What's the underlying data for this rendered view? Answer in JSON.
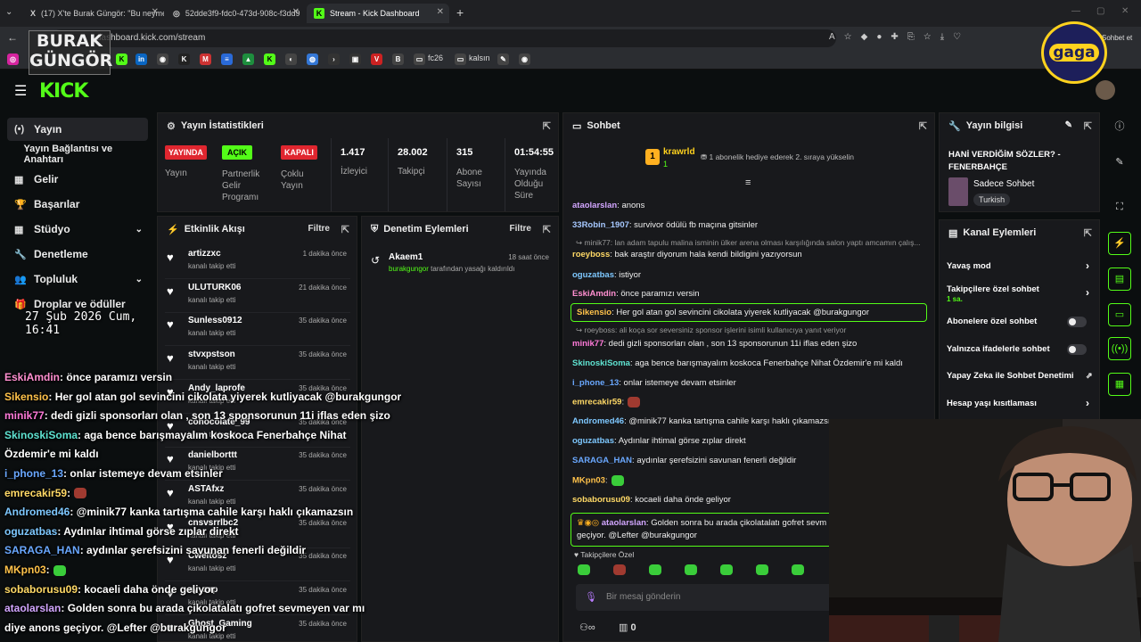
{
  "browser": {
    "tabs": [
      {
        "label": "(17) X'te Burak Güngör: \"Bu neyme",
        "icon": "X"
      },
      {
        "label": "52dde3f9-fdc0-473d-908c-f3dd9",
        "icon": "◎"
      },
      {
        "label": "Stream - Kick Dashboard",
        "icon": "K"
      }
    ],
    "url": "dashboard.kick.com/stream",
    "profile_label": "Sohbet et",
    "bookmarks": [
      "fc26",
      "kalsın"
    ]
  },
  "watermark": {
    "line1": "BURAK",
    "line2": "GÜNGÖR",
    "badge": "gaga"
  },
  "sidebar": {
    "items": [
      {
        "label": "Yayın",
        "icon": "(•)"
      },
      {
        "label": "Yayın Bağlantısı ve Anahtarı",
        "icon": ""
      },
      {
        "label": "Gelir",
        "icon": "▦"
      },
      {
        "label": "Başarılar",
        "icon": "🏆"
      },
      {
        "label": "Stüdyo",
        "icon": "▦",
        "chev": "⌄"
      },
      {
        "label": "Denetleme",
        "icon": "🔧"
      },
      {
        "label": "Topluluk",
        "icon": "👥",
        "chev": "⌄"
      },
      {
        "label": "Droplar ve ödüller",
        "icon": "🎁"
      }
    ],
    "clock": "27 Şub 2026 Cum, 16:41"
  },
  "stats": {
    "title": "Yayın İstatistikleri",
    "cols": [
      {
        "badge": "YAYINDA",
        "color": "#e0262f",
        "label": "Yayın"
      },
      {
        "badge": "AÇIK",
        "color": "#53fc18",
        "label": "Partnerlik Gelir Programı"
      },
      {
        "badge": "KAPALI",
        "color": "#e0262f",
        "label": "Çoklu Yayın"
      },
      {
        "value": "1.417",
        "label": "İzleyici"
      },
      {
        "value": "28.002",
        "label": "Takipçi"
      },
      {
        "value": "315",
        "label": "Abone Sayısı"
      },
      {
        "value": "01:54:55",
        "label": "Yayında Olduğu Süre"
      }
    ]
  },
  "activity": {
    "title": "Etkinlik Akışı",
    "filter": "Filtre",
    "items": [
      {
        "name": "artizzxc",
        "sub": "kanalı takip etti",
        "time": "1 dakika önce"
      },
      {
        "name": "ULUTURK06",
        "sub": "kanalı takip etti",
        "time": "21 dakika önce"
      },
      {
        "name": "Sunless0912",
        "sub": "kanalı takip etti",
        "time": "35 dakika önce"
      },
      {
        "name": "stvxpstson",
        "sub": "kanalı takip etti",
        "time": "35 dakika önce"
      },
      {
        "name": "Andy_laprofe",
        "sub": "kanalı takip etti",
        "time": "35 dakika önce"
      },
      {
        "name": "cohocolate_99",
        "sub": "kanalı takip etti",
        "time": "35 dakika önce"
      },
      {
        "name": "danielborttt",
        "sub": "kanalı takip etti",
        "time": "35 dakika önce"
      },
      {
        "name": "ASTAfxz",
        "sub": "kanalı takip etti",
        "time": "35 dakika önce"
      },
      {
        "name": "cnsvsrrlbc2",
        "sub": "kanalı takip etti",
        "time": "35 dakika önce"
      },
      {
        "name": "Cweltosz",
        "sub": "kanalı takip etti",
        "time": "35 dakika önce"
      },
      {
        "name": "ay_zap",
        "sub": "kanalı takip etti",
        "time": "35 dakika önce"
      },
      {
        "name": "Ghost_Gaming",
        "sub": "kanalı takip etti",
        "time": "35 dakika önce"
      }
    ]
  },
  "moderation": {
    "title": "Denetim Eylemleri",
    "filter": "Filtre",
    "item": {
      "name": "Akaem1",
      "time": "18 saat önce",
      "by": "burakgungor",
      "text": "tarafından yasağı kaldırıldı"
    }
  },
  "chat": {
    "title": "Sohbet",
    "pinned_user": "krawrld",
    "pinned_rank": "1",
    "pinned_count": "1",
    "gift_text": "1 abonelik hediye ederek 2. sıraya yükselin",
    "messages": [
      {
        "user": "ataolarslan",
        "color": "#d2a6ff",
        "text": ": anons"
      },
      {
        "user": "33Robin_1907",
        "color": "#a6c8ff",
        "text": ": survivor ödülü fb maçına gitsinler"
      },
      {
        "sys": "minik77: lan adam tapulu malina isminin ülker arena olması karşılığında salon yaptı amcamın çalış..."
      },
      {
        "user": "roeyboss",
        "color": "#ffd966",
        "text": ": bak araştır diyorum hala kendi bildigini yazıyorsun"
      },
      {
        "user": "oguzatbas",
        "color": "#7ec8ff",
        "text": ": istiyor"
      },
      {
        "user": "EskiAmdin",
        "color": "#ff8fd0",
        "text": ": önce paramızı versin"
      },
      {
        "user": "Sikensio",
        "color": "#ffc24a",
        "text": ": Her gol atan gol sevincini cikolata yiyerek kutliyacak @burakgungor",
        "hl": true
      },
      {
        "sys": "roeyboss: ali koça sor seversiniz sponsor işlerini isimli kullanıcıya yanıt veriyor"
      },
      {
        "user": "minik77",
        "color": "#ff7ad9",
        "text": ": dedi gizli sponsorları olan , son 13 sponsorunun 11i iflas eden şizo"
      },
      {
        "user": "SkinoskiSoma",
        "color": "#5fe3d1",
        "text": ": aga bence barışmayalım koskoca Fenerbahçe Nihat Özdemir'e mi kaldı"
      },
      {
        "user": "i_phone_13",
        "color": "#6aa8ff",
        "text": ": onlar istemeye devam etsinler"
      },
      {
        "user": "emrecakir59",
        "color": "#ffd966",
        "text": ":"
      },
      {
        "user": "Andromed46",
        "color": "#7ec8ff",
        "text": ": @minik77 kanka tartışma cahile karşı haklı çıkamazsın"
      },
      {
        "user": "oguzatbas",
        "color": "#7ec8ff",
        "text": ": Aydınlar ihtimal görse zıplar direkt"
      },
      {
        "user": "SARAGA_HAN",
        "color": "#6aa8ff",
        "text": ": aydınlar şerefsizini savunan fenerli değildir"
      },
      {
        "user": "MKpn03",
        "color": "#ffc24a",
        "text": ":"
      },
      {
        "user": "sobaborusu09",
        "color": "#ffd966",
        "text": ": kocaeli daha önde geliyor"
      }
    ],
    "last_user": "ataolarslan",
    "last_text": ": Golden sonra bu arada çikolatalatı gofret sevm",
    "last_text2": "geçiyor. @Lefter @burakgungor",
    "emote_label": "Takipçilere Özel",
    "input_placeholder": "Bir mesaj gönderin",
    "footer_count": "0"
  },
  "info": {
    "title": "Yayın bilgisi",
    "stream_title": "HANİ VERDİĞİM SÖZLER? - FENERBAHÇE",
    "category": "Sadece Sohbet",
    "language": "Turkish",
    "actions_title": "Kanal Eylemleri",
    "actions": [
      {
        "label": "Yavaş mod",
        "type": "chev"
      },
      {
        "label": "Takipçilere özel sohbet",
        "sub": "1 sa.",
        "type": "chev"
      },
      {
        "label": "Abonelere özel sohbet",
        "type": "toggle"
      },
      {
        "label": "Yalnızca ifadelerle sohbet",
        "type": "toggle"
      },
      {
        "label": "Yapay Zeka ile Sohbet Denetimi",
        "type": "ext"
      },
      {
        "label": "Hesap yaşı kısıtlaması",
        "type": "chev"
      }
    ]
  },
  "overlay": {
    "lines": [
      {
        "user": "EskiAmdin",
        "color": "#ff8fd0",
        "text": ": önce paramızı versin"
      },
      {
        "user": "Sikensio",
        "color": "#ffc24a",
        "text": ": Her gol atan gol sevincini cikolata yiyerek kutliyacak @burakgungor"
      },
      {
        "user": "minik77",
        "color": "#ff7ad9",
        "text": ": dedi gizli sponsorları olan , son 13 sponsorunun 11i iflas eden şizo"
      },
      {
        "user": "SkinoskiSoma",
        "color": "#5fe3d1",
        "text": ": aga bence barışmayalım koskoca Fenerbahçe Nihat"
      },
      {
        "user": "",
        "color": "#fff",
        "text": "Özdemir'e mi kaldı"
      },
      {
        "user": "i_phone_13",
        "color": "#6aa8ff",
        "text": ": onlar istemeye devam etsinler"
      },
      {
        "user": "emrecakir59",
        "color": "#ffd966",
        "text": ":"
      },
      {
        "user": "Andromed46",
        "color": "#7ec8ff",
        "text": ": @minik77 kanka tartışma cahile karşı haklı çıkamazsın"
      },
      {
        "user": "oguzatbas",
        "color": "#7ec8ff",
        "text": ": Aydınlar ihtimal görse zıplar direkt"
      },
      {
        "user": "SARAGA_HAN",
        "color": "#6aa8ff",
        "text": ": aydınlar şerefsizini savunan fenerli değildir"
      },
      {
        "user": "MKpn03",
        "color": "#ffc24a",
        "text": ":"
      },
      {
        "user": "sobaborusu09",
        "color": "#ffd966",
        "text": ": kocaeli daha önde geliyor"
      },
      {
        "user": "ataolarslan",
        "color": "#d2a6ff",
        "text": ": Golden sonra bu arada çikolatalatı gofret sevmeyen var mı"
      },
      {
        "user": "",
        "color": "#fff",
        "text": "diye anons geçiyor. @Lefter @burakgungor"
      }
    ]
  }
}
